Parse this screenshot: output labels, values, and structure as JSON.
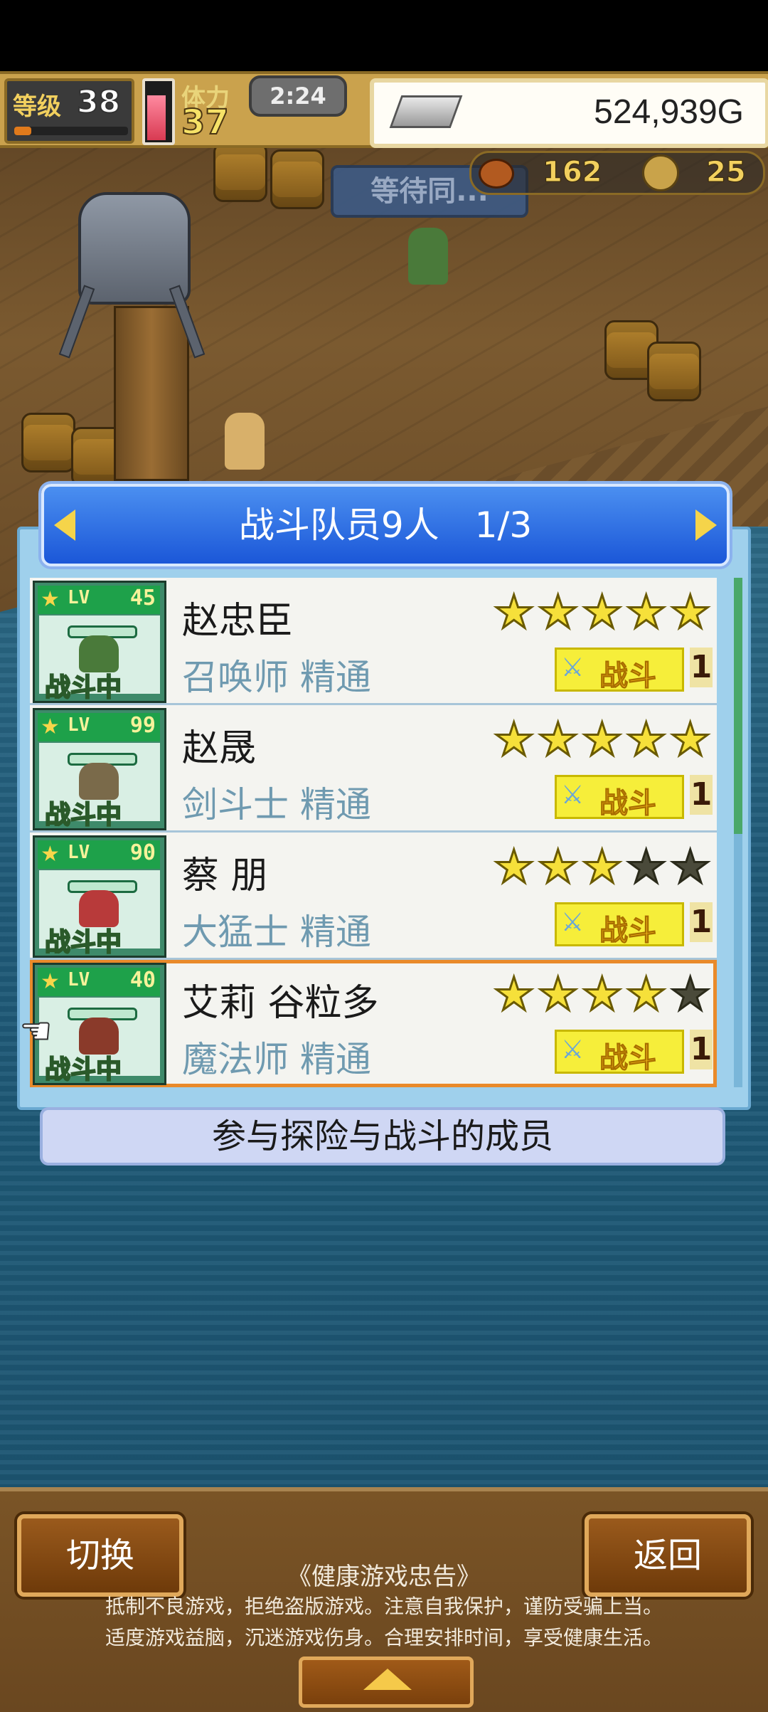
{
  "hud": {
    "level_label": "等级",
    "level_value": "38",
    "level_progress": 0.15,
    "stamina_label": "体力",
    "stamina_value": "37",
    "stamina_fill": 0.85,
    "clock": "2:24",
    "gold": "524,939G",
    "food": "162",
    "coins": "25"
  },
  "scene": {
    "waiting_sign": "等待同..."
  },
  "panel": {
    "title": "战斗队员9人　1/3",
    "caption": "参与探险与战斗的成员",
    "members": [
      {
        "name": "赵忠臣",
        "job": "召唤师 精通",
        "lv_label": "LV",
        "level": "45",
        "status": "战斗中",
        "stars": 5,
        "battle_label": "战斗",
        "battle_count": "1",
        "sprite_color": "#4a7a3a"
      },
      {
        "name": "赵晟",
        "job": "剑斗士 精通",
        "lv_label": "LV",
        "level": "99",
        "status": "战斗中",
        "stars": 5,
        "battle_label": "战斗",
        "battle_count": "1",
        "sprite_color": "#7a6a4a"
      },
      {
        "name": "蔡 朋",
        "job": "大猛士 精通",
        "lv_label": "LV",
        "level": "90",
        "status": "战斗中",
        "stars": 3,
        "battle_label": "战斗",
        "battle_count": "1",
        "sprite_color": "#b83a3a"
      },
      {
        "name": "艾莉 谷粒多",
        "job": "魔法师 精通",
        "lv_label": "LV",
        "level": "40",
        "status": "战斗中",
        "stars": 4,
        "battle_label": "战斗",
        "battle_count": "1",
        "sprite_color": "#8a3a2a"
      }
    ]
  },
  "bottom": {
    "switch_label": "切换",
    "back_label": "返回",
    "notice_title": "《健康游戏忠告》",
    "notice_line1": "抵制不良游戏，拒绝盗版游戏。注意自我保护，谨防受骗上当。",
    "notice_line2": "适度游戏益脑，沉迷游戏伤身。合理安排时间，享受健康生活。"
  }
}
